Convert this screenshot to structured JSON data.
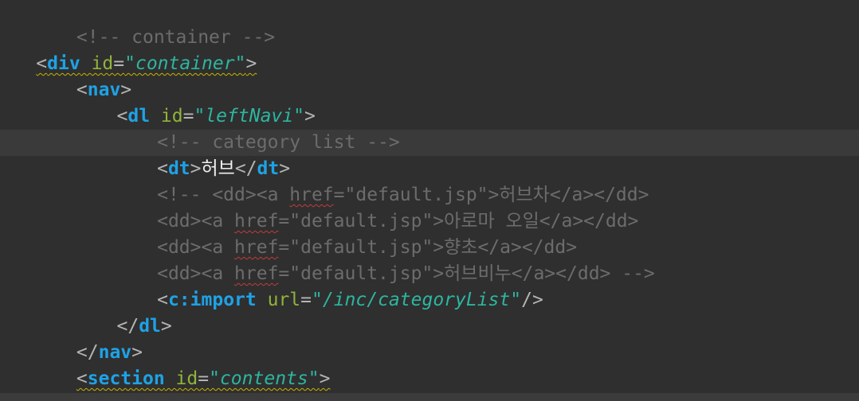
{
  "editor": {
    "lines": [
      {
        "indent": 3,
        "tokens": [
          {
            "t": "comment",
            "v": "<!-- container -->"
          }
        ]
      },
      {
        "indent": 1,
        "squiggle": "y",
        "tokens": [
          {
            "t": "punct",
            "v": "<"
          },
          {
            "t": "tag",
            "v": "div"
          },
          {
            "t": "punct",
            "v": " "
          },
          {
            "t": "attr",
            "v": "id"
          },
          {
            "t": "eq",
            "v": "="
          },
          {
            "t": "val",
            "v": "\"container\""
          },
          {
            "t": "punct",
            "v": ">"
          }
        ]
      },
      {
        "indent": 3,
        "tokens": [
          {
            "t": "punct",
            "v": "<"
          },
          {
            "t": "tag",
            "v": "nav"
          },
          {
            "t": "punct",
            "v": ">"
          }
        ]
      },
      {
        "indent": 5,
        "tokens": [
          {
            "t": "punct",
            "v": "<"
          },
          {
            "t": "tag",
            "v": "dl"
          },
          {
            "t": "punct",
            "v": " "
          },
          {
            "t": "attr",
            "v": "id"
          },
          {
            "t": "eq",
            "v": "="
          },
          {
            "t": "val",
            "v": "\"leftNavi\""
          },
          {
            "t": "punct",
            "v": ">"
          }
        ]
      },
      {
        "indent": 7,
        "current": true,
        "tokens": [
          {
            "t": "comment",
            "v": "<!-- category list -->"
          }
        ]
      },
      {
        "indent": 7,
        "tokens": [
          {
            "t": "punct",
            "v": "<"
          },
          {
            "t": "tag",
            "v": "dt"
          },
          {
            "t": "punct",
            "v": ">"
          },
          {
            "t": "text",
            "v": "허브"
          },
          {
            "t": "punct",
            "v": "</"
          },
          {
            "t": "tag",
            "v": "dt"
          },
          {
            "t": "punct",
            "v": ">"
          }
        ]
      },
      {
        "indent": 7,
        "tokens": [
          {
            "t": "comment",
            "v": "<!-- <dd><a "
          },
          {
            "t": "comment-r",
            "v": "href"
          },
          {
            "t": "comment",
            "v": "=\"default.jsp\">허브차</a></dd>"
          }
        ]
      },
      {
        "indent": 7,
        "tokens": [
          {
            "t": "comment",
            "v": "<dd><a "
          },
          {
            "t": "comment-r",
            "v": "href"
          },
          {
            "t": "comment",
            "v": "=\"default.jsp\">아로마 오일</a></dd>"
          }
        ]
      },
      {
        "indent": 7,
        "tokens": [
          {
            "t": "comment",
            "v": "<dd><a "
          },
          {
            "t": "comment-r",
            "v": "href"
          },
          {
            "t": "comment",
            "v": "=\"default.jsp\">향초</a></dd>"
          }
        ]
      },
      {
        "indent": 7,
        "tokens": [
          {
            "t": "comment",
            "v": "<dd><a "
          },
          {
            "t": "comment-r",
            "v": "href"
          },
          {
            "t": "comment",
            "v": "=\"default.jsp\">허브비누</a></dd> -->"
          }
        ]
      },
      {
        "indent": 7,
        "tokens": [
          {
            "t": "punct",
            "v": "<"
          },
          {
            "t": "tag",
            "v": "c:import"
          },
          {
            "t": "punct",
            "v": " "
          },
          {
            "t": "attr",
            "v": "url"
          },
          {
            "t": "eq",
            "v": "="
          },
          {
            "t": "val",
            "v": "\"/inc/categoryList\""
          },
          {
            "t": "punct",
            "v": "/>"
          }
        ]
      },
      {
        "indent": 5,
        "tokens": [
          {
            "t": "punct",
            "v": "</"
          },
          {
            "t": "tag",
            "v": "dl"
          },
          {
            "t": "punct",
            "v": ">"
          }
        ]
      },
      {
        "indent": 3,
        "tokens": [
          {
            "t": "punct",
            "v": "</"
          },
          {
            "t": "tag",
            "v": "nav"
          },
          {
            "t": "punct",
            "v": ">"
          }
        ]
      },
      {
        "indent": 3,
        "squiggle": "y",
        "tokens": [
          {
            "t": "punct",
            "v": "<"
          },
          {
            "t": "tag",
            "v": "section"
          },
          {
            "t": "punct",
            "v": " "
          },
          {
            "t": "attr",
            "v": "id"
          },
          {
            "t": "eq",
            "v": "="
          },
          {
            "t": "val",
            "v": "\"contents\""
          },
          {
            "t": "punct",
            "v": ">"
          }
        ]
      }
    ]
  }
}
